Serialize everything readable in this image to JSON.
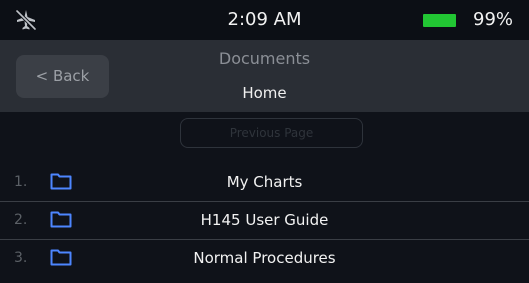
{
  "status_bar": {
    "time": "2:09 AM",
    "battery_text": "99%",
    "battery_color": "#22c633",
    "left_icon": "airplane-mode-off-icon"
  },
  "header": {
    "title": "Documents",
    "subtitle": "Home",
    "back_label": "< Back"
  },
  "previous_page_label": "Previous Page",
  "documents": [
    {
      "index": "1.",
      "label": "My Charts",
      "icon": "folder-icon"
    },
    {
      "index": "2.",
      "label": "H145 User Guide",
      "icon": "folder-icon"
    },
    {
      "index": "3.",
      "label": "Normal Procedures",
      "icon": "folder-icon"
    }
  ],
  "colors": {
    "accent": "#4d86ff",
    "header_bg": "#2a2e35",
    "screen_bg": "#0f1219"
  }
}
